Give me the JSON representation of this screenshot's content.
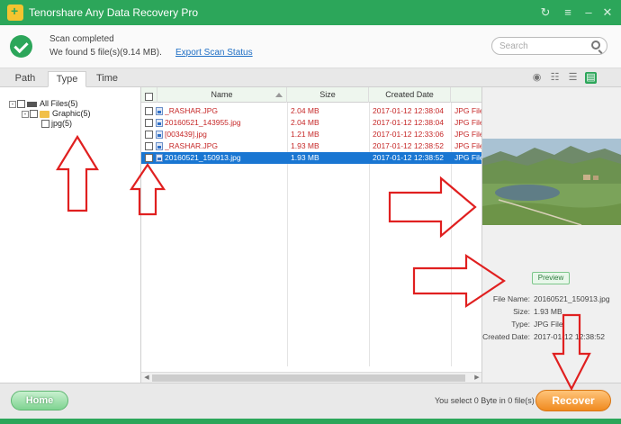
{
  "app": {
    "title": "Tenorshare Any Data Recovery Pro"
  },
  "status": {
    "headline": "Scan completed",
    "detail": "We found 5 file(s)(9.14 MB).",
    "export_link": "Export Scan Status"
  },
  "search": {
    "placeholder": "Search",
    "value": ""
  },
  "tabs": [
    {
      "label": "Path",
      "active": false
    },
    {
      "label": "Type",
      "active": true
    },
    {
      "label": "Time",
      "active": false
    }
  ],
  "view_icons": [
    "eye-icon",
    "grid-view-icon",
    "list-view-icon",
    "detail-view-icon"
  ],
  "tree": {
    "items": [
      {
        "label": "All Files(5)",
        "icon": "drive-icon",
        "expander": "-"
      },
      {
        "label": "Graphic(5)",
        "icon": "folder-icon",
        "expander": "-"
      },
      {
        "label": "jpg(5)",
        "icon": "",
        "expander": ""
      }
    ]
  },
  "file_list": {
    "columns": [
      "Name",
      "Size",
      "Created Date",
      ""
    ],
    "rows": [
      {
        "name": "_RASHAR.JPG",
        "size": "2.04 MB",
        "date": "2017-01-12 12:38:04",
        "type": "JPG File",
        "selected": false
      },
      {
        "name": "20160521_143955.jpg",
        "size": "2.04 MB",
        "date": "2017-01-12 12:38:04",
        "type": "JPG File",
        "selected": false
      },
      {
        "name": "[003439].jpg",
        "size": "1.21 MB",
        "date": "2017-01-12 12:33:06",
        "type": "JPG File",
        "selected": false
      },
      {
        "name": "_RASHAR.JPG",
        "size": "1.93 MB",
        "date": "2017-01-12 12:38:52",
        "type": "JPG File",
        "selected": false
      },
      {
        "name": "20160521_150913.jpg",
        "size": "1.93 MB",
        "date": "2017-01-12 12:38:52",
        "type": "JPG File",
        "selected": true
      }
    ]
  },
  "preview": {
    "button_label": "Preview",
    "labels": {
      "file_name": "File Name:",
      "size": "Size:",
      "type": "Type:",
      "created_date": "Created Date:"
    },
    "values": {
      "file_name": "20160521_150913.jpg",
      "size": "1.93 MB",
      "type": "JPG File",
      "created_date": "2017-01-12 12:38:52"
    }
  },
  "bottom": {
    "home_label": "Home",
    "select_status": "You select 0 Byte in 0 file(s)",
    "recover_label": "Recover"
  },
  "colors": {
    "brand_green": "#2ca65a",
    "selection_blue": "#1976d2",
    "deleted_red": "#c62828",
    "recover_orange": "#f08a1f",
    "annotation_red": "#e02020"
  }
}
